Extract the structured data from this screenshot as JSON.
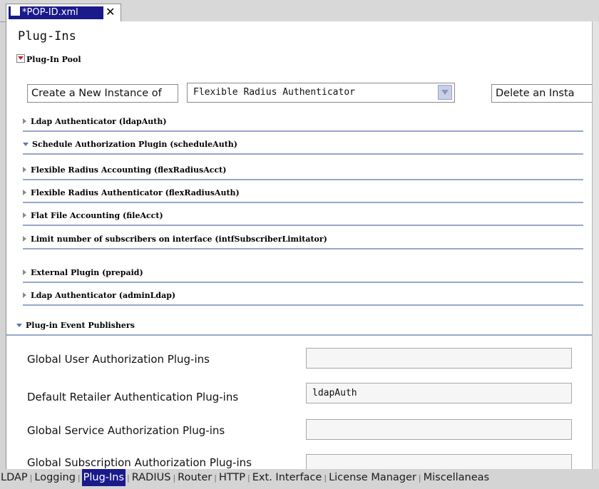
{
  "editor_tab": {
    "title": "*POP-ID.xml",
    "close": "✕"
  },
  "page_title": "Plug-Ins",
  "plugin_pool": {
    "header": "Plug-In Pool",
    "create_button": "Create a New Instance of",
    "selected_type": "Flexible Radius Authenticator",
    "delete_button": "Delete an Insta",
    "items": [
      {
        "label": "Ldap Authenticator (ldapAuth)",
        "expanded": false
      },
      {
        "label": "Schedule Authorization Plugin (scheduleAuth)",
        "expanded": true
      },
      {
        "label": "Flexible Radius Accounting (flexRadiusAcct)",
        "expanded": false
      },
      {
        "label": "Flexible Radius Authenticator (flexRadiusAuth)",
        "expanded": false
      },
      {
        "label": "Flat File Accounting (fileAcct)",
        "expanded": false
      },
      {
        "label": "Limit number of subscribers on interface (intfSubscriberLimitator)",
        "expanded": false
      },
      {
        "label": "External Plugin (prepaid)",
        "expanded": false
      },
      {
        "label": "Ldap Authenticator (adminLdap)",
        "expanded": false
      }
    ]
  },
  "event_publishers": {
    "header": "Plug-in Event Publishers",
    "fields": [
      {
        "label": "Global User Authorization Plug-ins",
        "value": ""
      },
      {
        "label": "Default Retailer Authentication Plug-ins",
        "value": "ldapAuth"
      },
      {
        "label": "Global Service Authorization Plug-ins",
        "value": ""
      },
      {
        "label": "Global Subscription Authorization Plug-ins",
        "value": ""
      }
    ]
  },
  "bottom_tabs": [
    {
      "label": "LDAP",
      "active": false
    },
    {
      "label": "Logging",
      "active": false
    },
    {
      "label": "Plug-Ins",
      "active": true
    },
    {
      "label": "RADIUS",
      "active": false
    },
    {
      "label": "Router",
      "active": false
    },
    {
      "label": "HTTP",
      "active": false
    },
    {
      "label": "Ext. Interface",
      "active": false
    },
    {
      "label": "License Manager",
      "active": false
    },
    {
      "label": "Miscellaneas",
      "active": false
    }
  ],
  "colors": {
    "selection": "#1a1a8c",
    "divider": "#97a7cc",
    "expand_arrow": "#cc2222"
  }
}
